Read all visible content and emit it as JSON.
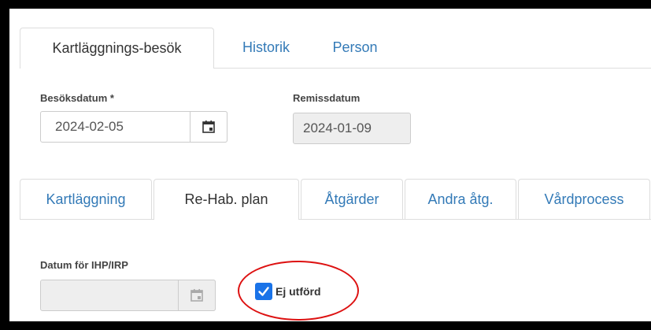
{
  "top_tabs": [
    {
      "label": "Kartläggnings-besök",
      "active": true
    },
    {
      "label": "Historik",
      "active": false
    },
    {
      "label": "Person",
      "active": false
    }
  ],
  "visit_date": {
    "label": "Besöksdatum *",
    "value": "2024-02-05"
  },
  "referral_date": {
    "label": "Remissdatum",
    "value": "2024-01-09"
  },
  "sub_tabs": [
    {
      "label": "Kartläggning",
      "active": false
    },
    {
      "label": "Re-Hab. plan",
      "active": true
    },
    {
      "label": "Åtgärder",
      "active": false
    },
    {
      "label": "Andra åtg.",
      "active": false
    },
    {
      "label": "Vårdprocess",
      "active": false
    }
  ],
  "ihp_date": {
    "label": "Datum för IHP/IRP",
    "value": ""
  },
  "not_done": {
    "label": "Ej utförd",
    "checked": true
  },
  "colors": {
    "link": "#337ab7",
    "checkbox": "#1a73e8",
    "annotation": "#dd1111"
  }
}
